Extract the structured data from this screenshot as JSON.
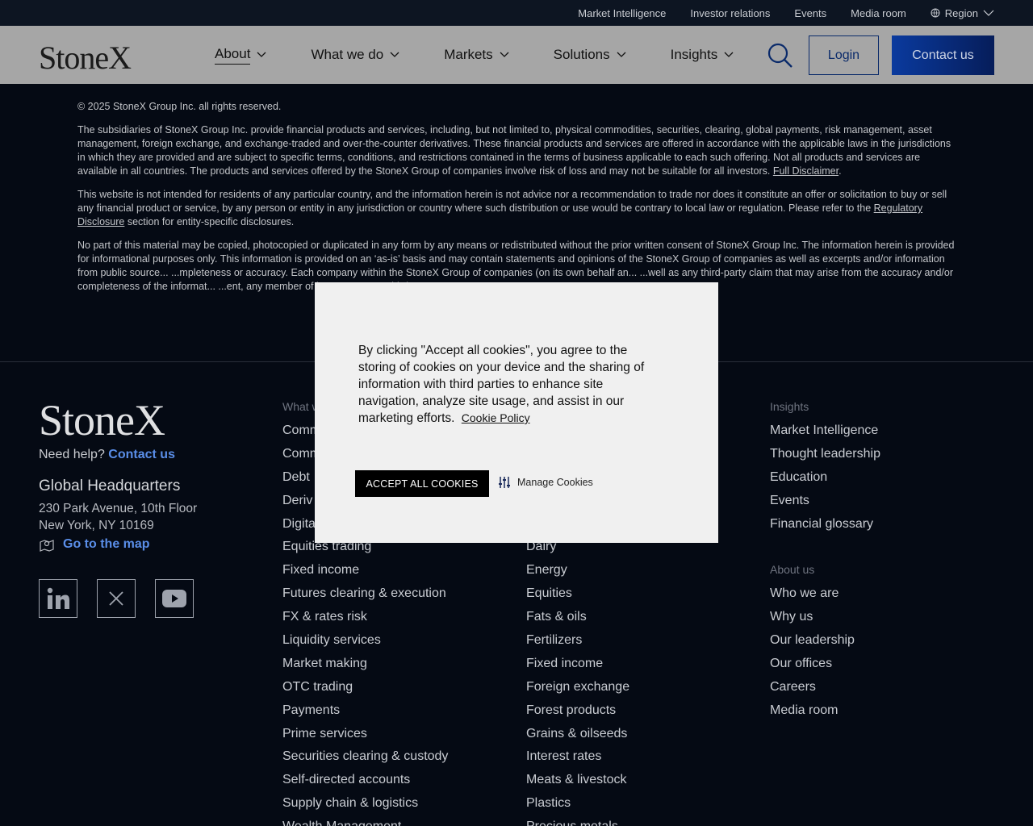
{
  "utility_bar": {
    "links": [
      "Market Intelligence",
      "Investor relations",
      "Events",
      "Media room"
    ],
    "region_label": "Region"
  },
  "header": {
    "logo": "StoneX",
    "nav": [
      {
        "label": "About",
        "active": true
      },
      {
        "label": "What we do",
        "active": false
      },
      {
        "label": "Markets",
        "active": false
      },
      {
        "label": "Solutions",
        "active": false
      },
      {
        "label": "Insights",
        "active": false
      }
    ],
    "login_label": "Login",
    "contact_label": "Contact us"
  },
  "legal": {
    "copyright": "© 2025 StoneX Group Inc. all rights reserved.",
    "p1": "The subsidiaries of StoneX Group Inc. provide financial products and services, including, but not limited to, physical commodities, securities, clearing, global payments, risk management, asset management, foreign exchange, and exchange-traded and over-the-counter derivatives. These financial products and services are offered in accordance with the applicable laws in the jurisdictions in which they are provided and are subject to specific terms, conditions, and restrictions contained in the terms of business applicable to each such offering. Not all products and services are available in all countries. The products and services offered by the StoneX Group of companies involve risk of loss and may not be suitable for all investors.",
    "p1_link": "Full Disclaimer",
    "p2_start": "This website is not intended for residents of any particular country, and the information herein is not advice nor a recommendation to trade nor does it constitute an offer or solicitation to buy or sell any financial product or service, by any person or entity in any jurisdiction or country where such distribution or use would be contrary to local law or regulation. Please refer to the",
    "p2_link": "Regulatory Disclosure",
    "p2_end": "section for entity-specific disclosures.",
    "p3": "No part of this material may be copied, photocopied or duplicated in any form by any means or redistributed without the prior written consent of StoneX Group Inc. The information herein is provided for informational purposes only. This information is provided on an ‘as-is’ basis and may contain statements and opinions of the StoneX Group of companies as well as excerpts and/or information from public source... ...mpleteness or accuracy. Each company within the StoneX Group of companies (on its own behalf an... ...well as any third-party claim that may arise from the accuracy and/or completeness of the informat... ...ent, any member of its group or any third party."
  },
  "footer": {
    "logo": "StoneX",
    "help_text": "Need help?",
    "help_link": "Contact us",
    "hq_title": "Global Headquarters",
    "addr_line1": "230 Park Avenue, 10th Floor",
    "addr_line2": "New York, NY 10169",
    "map_link": "Go to the map",
    "col1": {
      "heading": "What w",
      "items": [
        "Comm",
        "Comm",
        "Debt",
        "Deriv",
        "Digita",
        "Equities trading",
        "Fixed income",
        "Futures clearing & execution",
        "FX & rates risk",
        "Liquidity services",
        "Market making",
        "OTC trading",
        "Payments",
        "Prime services",
        "Securities clearing & custody",
        "Self-directed accounts",
        "Supply chain & logistics",
        "Wealth Management"
      ]
    },
    "col2": {
      "items": [
        "",
        "",
        "",
        "",
        "",
        "Dairy",
        "Energy",
        "Equities",
        "Fats & oils",
        "Fertilizers",
        "Fixed income",
        "Foreign exchange",
        "Forest products",
        "Grains & oilseeds",
        "Interest rates",
        "Meats & livestock",
        "Plastics",
        "Precious metals"
      ]
    },
    "col3": {
      "heading": "Insights",
      "items": [
        "Market Intelligence",
        "Thought leadership",
        "Education",
        "Events",
        "Financial glossary"
      ],
      "heading2": "About us",
      "items2": [
        "Who we are",
        "Why us",
        "Our leadership",
        "Our offices",
        "Careers",
        "Media room"
      ]
    }
  },
  "cookie_modal": {
    "message": "By clicking \"Accept all cookies\", you agree to the storing of cookies on your device and the sharing of information with third parties to enhance site navigation, analyze site usage, and assist in our marketing efforts.",
    "policy_link": "Cookie Policy",
    "accept_label": "ACCEPT ALL COOKIES",
    "manage_label": "Manage Cookies"
  }
}
